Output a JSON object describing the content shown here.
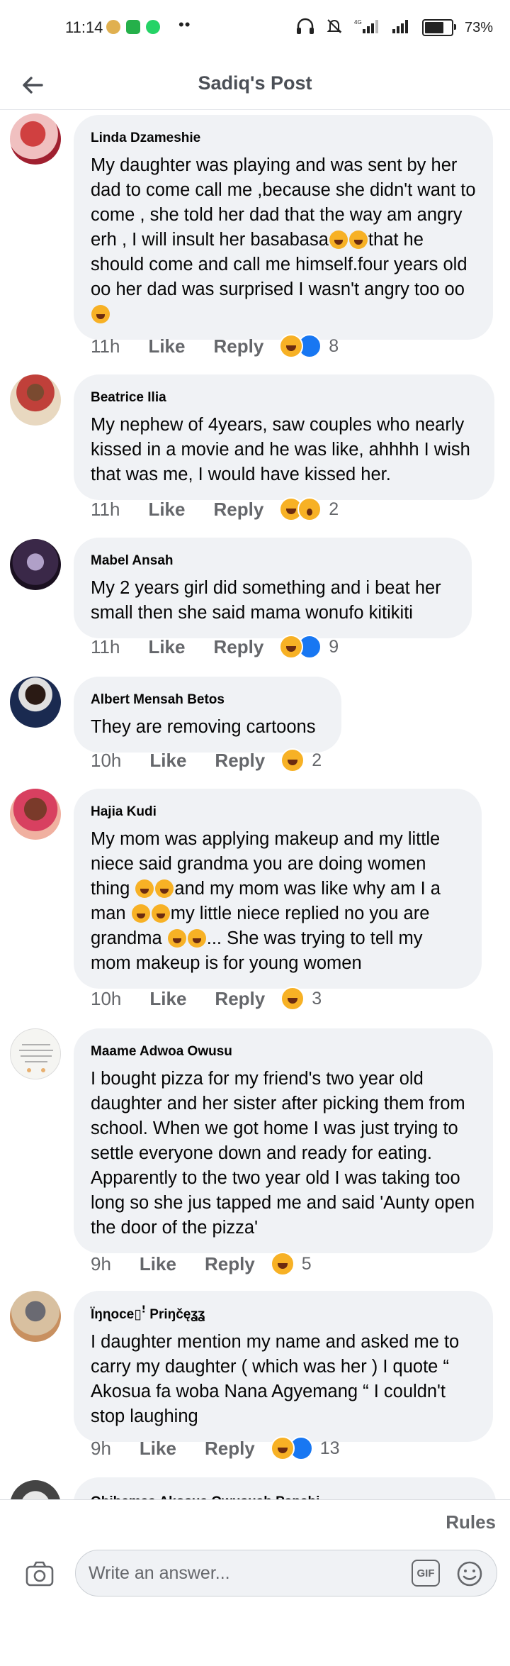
{
  "status_bar": {
    "time": "11:14",
    "battery_percent_label": "73%",
    "battery_level": 0.73
  },
  "header": {
    "title": "Sadiq's Post"
  },
  "comments": [
    {
      "author": "Linda Dzameshie",
      "text": "My daughter was playing and was sent by her dad to come call me ,because she didn't want to come , she told her dad that the way am angry erh , I will insult her basabasa",
      "text_tail": "that he should come and call me himself.four years old oo her dad was surprised I wasn't angry too oo",
      "time": "11h",
      "like_label": "Like",
      "reply_label": "Reply",
      "reaction_count": "8"
    },
    {
      "author": "Beatrice Ilia",
      "text": "My nephew of 4years, saw couples who nearly kissed in a movie and he was like, ahhhh I wish that was me, I would have kissed her.",
      "time": "11h",
      "like_label": "Like",
      "reply_label": "Reply",
      "reaction_count": "2"
    },
    {
      "author": "Mabel Ansah",
      "text": "My 2 years girl did something and i beat her small then she said mama wonufo kitikiti",
      "time": "11h",
      "like_label": "Like",
      "reply_label": "Reply",
      "reaction_count": "9"
    },
    {
      "author": "Albert Mensah Betos",
      "text": "They are removing cartoons",
      "time": "10h",
      "like_label": "Like",
      "reply_label": "Reply",
      "reaction_count": "2"
    },
    {
      "author": "Hajia Kudi",
      "text_a": "My mom was applying makeup and my little niece said grandma you are doing women thing",
      "text_b": "and my mom was like why am I a man",
      "text_c": "my little niece replied no you are grandma",
      "text_d": "... She was trying to tell my mom makeup is for young women",
      "time": "10h",
      "like_label": "Like",
      "reply_label": "Reply",
      "reaction_count": "3"
    },
    {
      "author": "Maame Adwoa Owusu",
      "text": "I bought pizza for my friend's two year old daughter and her sister after picking them from school. When we got home I was just trying to settle everyone down and ready for eating. Apparently to the two year old I was taking too long so she jus tapped me and said 'Aunty open the door of the pizza'",
      "time": "9h",
      "like_label": "Like",
      "reply_label": "Reply",
      "reaction_count": "5"
    },
    {
      "author": "Ïŋɳoce▯ꜝ Priŋčęʓʓ",
      "text": "I daughter mention my name and asked me to carry my daughter ( which was her ) I quote “ Akosua fa woba Nana Agyemang “ I couldn't stop laughing",
      "time": "9h",
      "like_label": "Like",
      "reply_label": "Reply",
      "reaction_count": "13"
    },
    {
      "author": "Obihemaa Akosua Owusuah Papabi"
    }
  ],
  "bottom_bar": {
    "rules_label": "Rules",
    "input_placeholder": "Write an answer...",
    "gif_label": "GIF"
  }
}
